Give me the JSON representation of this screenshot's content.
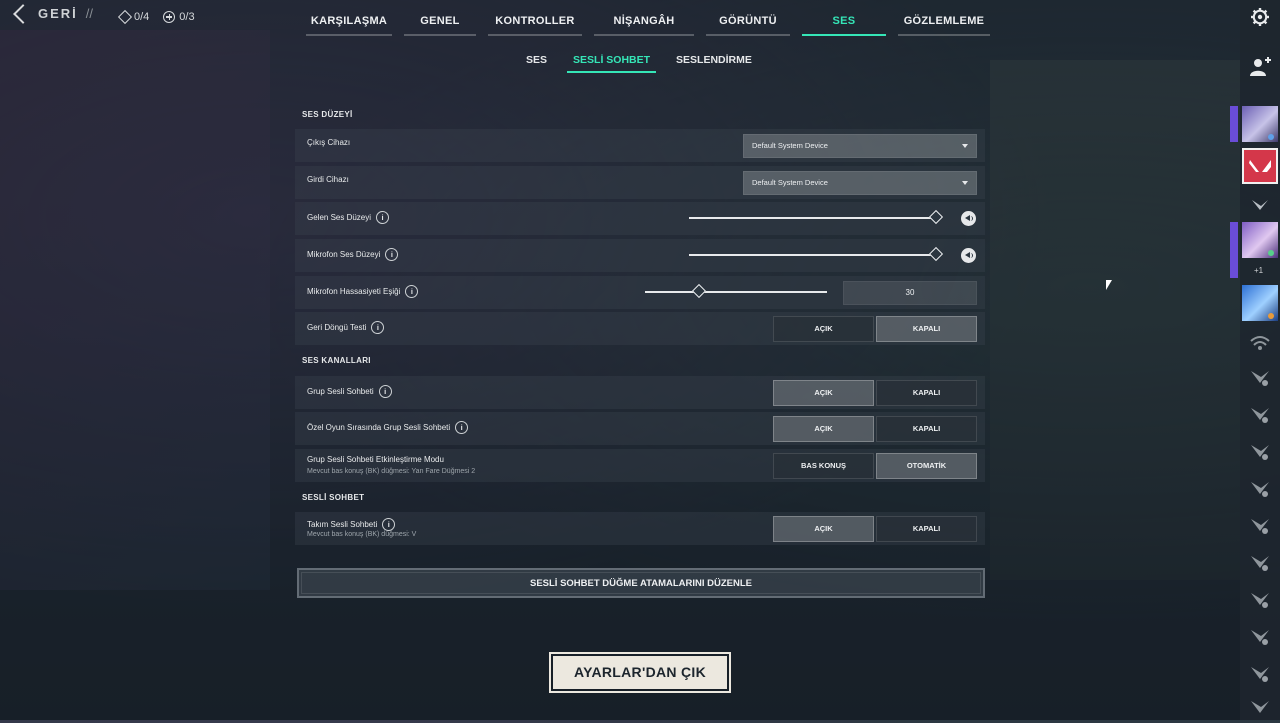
{
  "topbar": {
    "back_label": "GERİ",
    "separator": "//",
    "counter_a": "0/4",
    "counter_b": "0/3"
  },
  "tabs": [
    {
      "label": "KARŞILAŞMA",
      "active": false
    },
    {
      "label": "GENEL",
      "active": false
    },
    {
      "label": "KONTROLLER",
      "active": false
    },
    {
      "label": "NİŞANGÂH",
      "active": false
    },
    {
      "label": "GÖRÜNTÜ",
      "active": false
    },
    {
      "label": "SES",
      "active": true
    },
    {
      "label": "GÖZLEMLEME",
      "active": false
    }
  ],
  "subtabs": [
    {
      "label": "SES",
      "active": false
    },
    {
      "label": "SESLİ SOHBET",
      "active": true
    },
    {
      "label": "SESLENDİRME",
      "active": false
    }
  ],
  "sections": {
    "volume": "SES DÜZEYİ",
    "channels": "SES KANALLARI",
    "voice_chat": "SESLİ SOHBET"
  },
  "rows": {
    "output_device": {
      "label": "Çıkış Cihazı",
      "value": "Default System Device"
    },
    "input_device": {
      "label": "Girdi Cihazı",
      "value": "Default System Device"
    },
    "incoming_volume": {
      "label": "Gelen Ses Düzeyi",
      "level": 1.0
    },
    "mic_volume": {
      "label": "Mikrofon Ses Düzeyi",
      "level": 1.0
    },
    "mic_threshold": {
      "label": "Mikrofon Hassasiyeti Eşiği",
      "value": "30"
    },
    "loopback": {
      "label": "Geri Döngü Testi",
      "on": "AÇIK",
      "off": "KAPALI",
      "selected": "off"
    },
    "party_voice": {
      "label": "Grup Sesli Sohbeti",
      "on": "AÇIK",
      "off": "KAPALI",
      "selected": "on"
    },
    "custom_party_voice": {
      "label": "Özel Oyun Sırasında Grup Sesli Sohbeti",
      "on": "AÇIK",
      "off": "KAPALI",
      "selected": "on"
    },
    "party_activation": {
      "label": "Grup Sesli Sohbeti Etkinleştirme Modu",
      "sub": "Mevcut bas konuş (BK) düğmesi: Yan Fare Düğmesi 2",
      "opt1": "BAS KONUŞ",
      "opt2": "OTOMATİK",
      "selected": "opt2"
    },
    "team_voice": {
      "label": "Takım Sesli Sohbeti",
      "sub": "Mevcut bas konuş (BK) düğmesi: V",
      "on": "AÇIK",
      "off": "KAPALI",
      "selected": "on"
    }
  },
  "buttons": {
    "edit_bindings": "SESLİ SOHBET DÜĞME ATAMALARINI DÜZENLE",
    "exit_settings": "AYARLAR'DAN ÇIK"
  },
  "sidebar": {
    "plus_count": "+1",
    "icons": [
      "gear-icon",
      "add-friend-icon"
    ]
  },
  "colors": {
    "accent": "#35e6b7",
    "exit_button_bg": "#ece8df"
  }
}
